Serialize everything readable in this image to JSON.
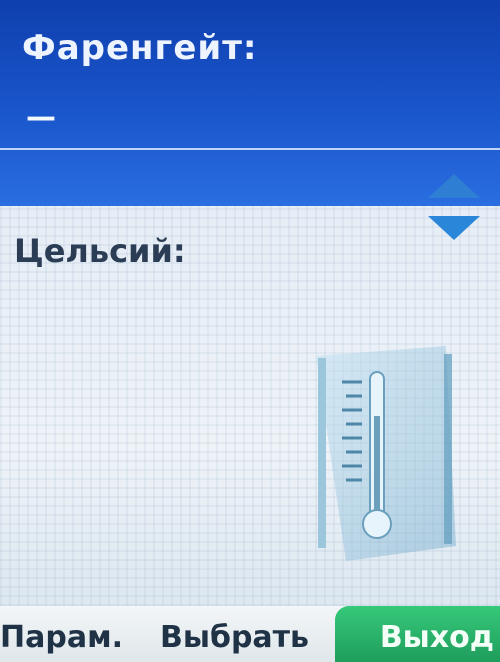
{
  "fahrenheit": {
    "label": "Фаренгейт:",
    "value": "—"
  },
  "celsius": {
    "label": "Цельсий:"
  },
  "softkeys": {
    "left": "Парам.",
    "middle": "Выбрать",
    "right": "Выход"
  },
  "colors": {
    "selected_field": "#1a56cc",
    "exit_key": "#2bb36a"
  },
  "icons": {
    "scroll": [
      "scroll-up-icon",
      "scroll-down-icon"
    ],
    "art": "thermometer-icon"
  }
}
